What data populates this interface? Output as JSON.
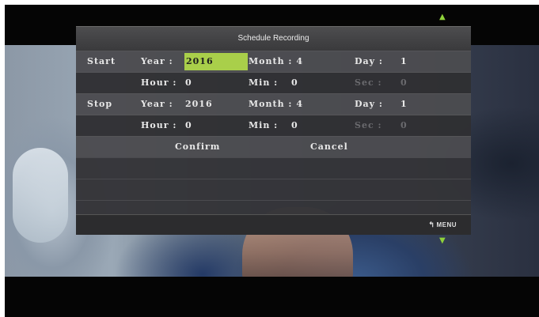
{
  "dialog": {
    "title": "Schedule Recording"
  },
  "start": {
    "section_label": "Start",
    "year_label": "Year :",
    "year_value": "2016",
    "month_label": "Month :",
    "month_value": "4",
    "day_label": "Day :",
    "day_value": "1",
    "hour_label": "Hour :",
    "hour_value": "0",
    "min_label": "Min :",
    "min_value": "0",
    "sec_label": "Sec :",
    "sec_value": "0"
  },
  "stop": {
    "section_label": "Stop",
    "year_label": "Year :",
    "year_value": "2016",
    "month_label": "Month :",
    "month_value": "4",
    "day_label": "Day :",
    "day_value": "1",
    "hour_label": "Hour :",
    "hour_value": "0",
    "min_label": "Min :",
    "min_value": "0",
    "sec_label": "Sec :",
    "sec_value": "0"
  },
  "actions": {
    "confirm_label": "Confirm",
    "cancel_label": "Cancel"
  },
  "footer": {
    "menu_label": "MENU",
    "menu_icon": "return-arrow-icon"
  },
  "colors": {
    "highlight": "#a9cf4a",
    "arrow": "#8fd23a"
  }
}
